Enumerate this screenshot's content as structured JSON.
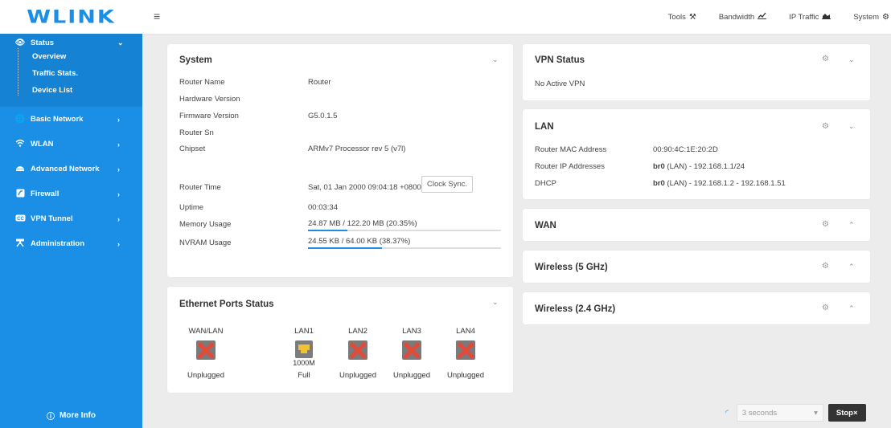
{
  "brand": {
    "logo": "WLINK"
  },
  "topbar": {
    "menu_icon": "≡",
    "links": [
      {
        "label": "Tools",
        "icon": "tools-icon"
      },
      {
        "label": "Bandwidth",
        "icon": "chart-line-icon"
      },
      {
        "label": "IP Traffic",
        "icon": "chart-area-icon"
      },
      {
        "label": "System",
        "icon": "gear-icon"
      }
    ]
  },
  "sidebar": {
    "items": [
      {
        "label": "Status",
        "icon": "eye-icon",
        "expanded": true,
        "children": [
          {
            "label": "Overview",
            "active": true
          },
          {
            "label": "Traffic Stats."
          },
          {
            "label": "Device List"
          }
        ]
      },
      {
        "label": "Basic Network",
        "icon": "globe-icon"
      },
      {
        "label": "WLAN",
        "icon": "wifi-icon"
      },
      {
        "label": "Advanced Network",
        "icon": "advanced-network-icon"
      },
      {
        "label": "Firewall",
        "icon": "firewall-icon"
      },
      {
        "label": "VPN Tunnel",
        "icon": "vpn-icon"
      },
      {
        "label": "Administration",
        "icon": "admin-icon"
      }
    ],
    "more_info": "More Info"
  },
  "system": {
    "title": "System",
    "rows": [
      {
        "label": "Router Name",
        "value": "Router"
      },
      {
        "label": "Hardware Version",
        "value": ""
      },
      {
        "label": "Firmware Version",
        "value": "G5.0.1.5"
      },
      {
        "label": "Router Sn",
        "value": ""
      },
      {
        "label": "Chipset",
        "value": "ARMv7 Processor rev 5 (v7l)"
      }
    ],
    "router_time_label": "Router Time",
    "router_time_value": "Sat, 01 Jan 2000 09:04:18 +0800",
    "clock_sync_label": "Clock Sync.",
    "uptime_label": "Uptime",
    "uptime_value": "00:03:34",
    "memory_label": "Memory Usage",
    "memory_value": "24.87 MB / 122.20 MB (20.35%)",
    "memory_percent": 20.35,
    "nvram_label": "NVRAM Usage",
    "nvram_value": "24.55 KB / 64.00 KB (38.37%)",
    "nvram_percent": 38.37
  },
  "ethernet": {
    "title": "Ethernet Ports Status",
    "ports": [
      {
        "name": "WAN/LAN",
        "state": "Unplugged",
        "connected": false,
        "speed": ""
      },
      {
        "name": "LAN1",
        "state": "Full",
        "connected": true,
        "speed": "1000M"
      },
      {
        "name": "LAN2",
        "state": "Unplugged",
        "connected": false,
        "speed": ""
      },
      {
        "name": "LAN3",
        "state": "Unplugged",
        "connected": false,
        "speed": ""
      },
      {
        "name": "LAN4",
        "state": "Unplugged",
        "connected": false,
        "speed": ""
      }
    ]
  },
  "vpn": {
    "title": "VPN Status",
    "text": "No Active VPN"
  },
  "lan": {
    "title": "LAN",
    "rows": [
      {
        "label": "Router MAC Address",
        "prefix": "",
        "value": "00:90:4C:1E:20:2D"
      },
      {
        "label": "Router IP Addresses",
        "prefix": "br0",
        "value": " (LAN) - 192.168.1.1/24"
      },
      {
        "label": "DHCP",
        "prefix": "br0",
        "value": " (LAN) - 192.168.1.2 - 192.168.1.51"
      }
    ]
  },
  "wan": {
    "title": "WAN"
  },
  "wireless5": {
    "title": "Wireless (5 GHz)"
  },
  "wireless24": {
    "title": "Wireless (2.4 GHz)"
  },
  "refresh": {
    "interval": "3 seconds",
    "stop_label": "Stop",
    "stop_icon": "×"
  },
  "colors": {
    "accent": "#1b8fe6",
    "sidebar_bg": "#1b8fe6",
    "unplugged": "#e24b3a",
    "port_led": "#f2c230"
  }
}
